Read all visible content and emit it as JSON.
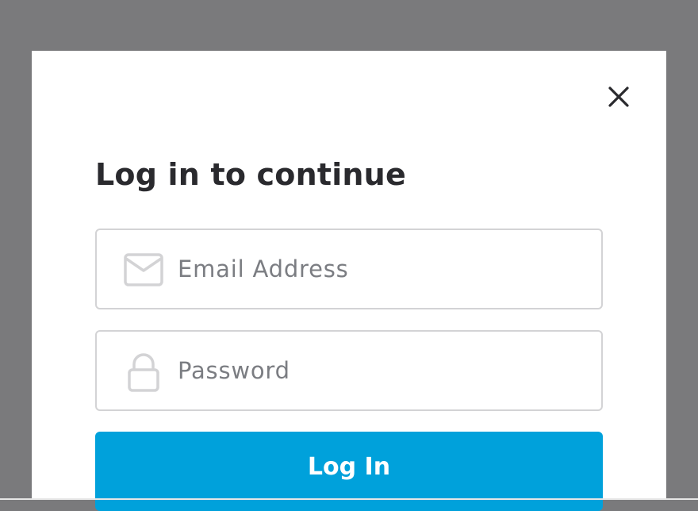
{
  "modal": {
    "title": "Log in to continue",
    "close_icon": "close-icon"
  },
  "email": {
    "placeholder": "Email Address",
    "value": "",
    "icon": "envelope-icon"
  },
  "password": {
    "placeholder": "Password",
    "value": "",
    "icon": "lock-icon"
  },
  "login_button": {
    "label": "Log In"
  },
  "colors": {
    "overlay": "#7a7a7c",
    "accent": "#00a1db",
    "title": "#2a2a2e",
    "placeholder": "#7b7d82",
    "field_border": "#d3d3d5"
  }
}
